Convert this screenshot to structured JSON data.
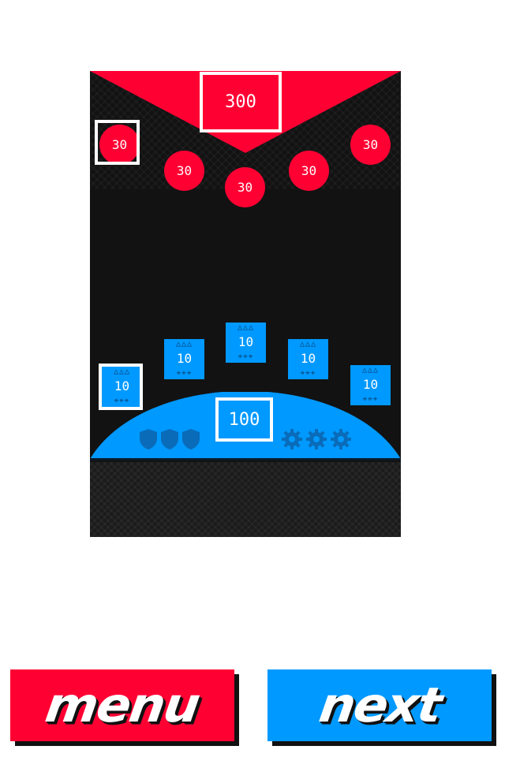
{
  "enemy": {
    "score": "300",
    "units": [
      "30",
      "30",
      "30",
      "30",
      "30"
    ],
    "color": "#ff0033"
  },
  "player": {
    "score": "100",
    "units": [
      "10",
      "10",
      "10",
      "10",
      "10"
    ],
    "unit_top_icons": "△△△",
    "unit_bottom_icons": "⌖⌖⌖",
    "color": "#0099ff",
    "shield_icons": [
      "shield-icon",
      "shield-icon",
      "shield-icon"
    ],
    "gear_icons": [
      "gear-icon",
      "gear-icon",
      "gear-icon"
    ]
  },
  "buttons": {
    "menu_label": "menu",
    "next_label": "next"
  }
}
